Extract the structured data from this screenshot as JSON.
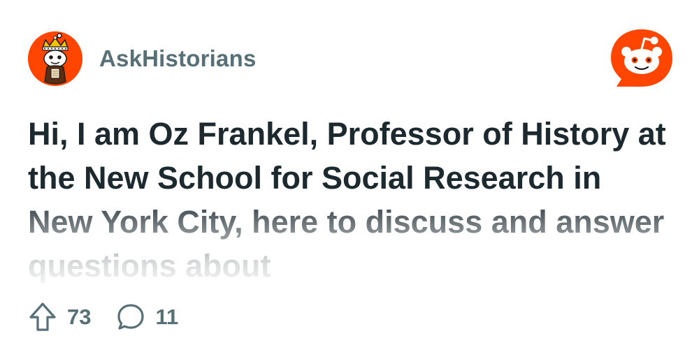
{
  "subreddit": {
    "name": "AskHistorians",
    "avatar_icon": "askhistorians-avatar-icon",
    "accent_color": "#ff4500"
  },
  "brand": {
    "logo_icon": "reddit-logo-icon",
    "color": "#ff4500"
  },
  "post": {
    "title": "Hi, I am Oz Frankel, Professor of History at the New School for Social Research in New York City, here to discuss and answer questions about"
  },
  "stats": {
    "upvotes": "73",
    "comments": "11",
    "upvote_icon": "upvote-arrow-icon",
    "comment_icon": "comment-bubble-icon"
  }
}
